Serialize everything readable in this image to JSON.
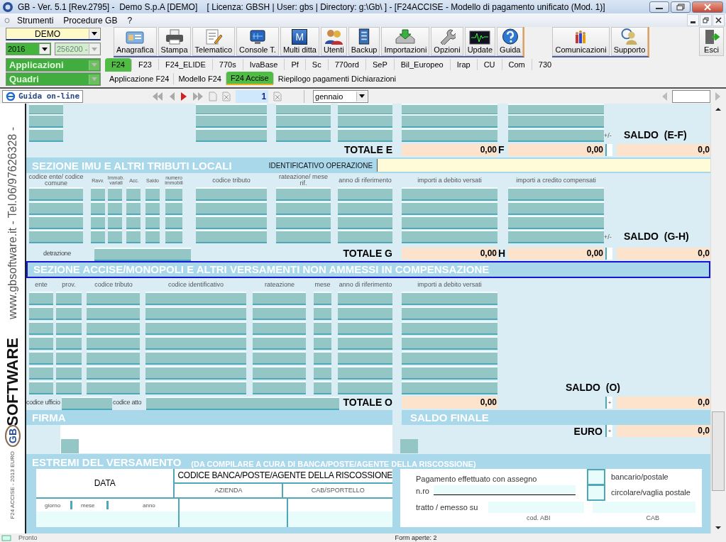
{
  "window": {
    "title": "GB - Ver. 5.1 [Rev.2795] -  Demo S.p.A [DEMO]    [ Licenza: GBSH | User: gbs | Directory: g:\\Gb\\ ] - [F24ACCISE - Modello di pagamento unificato (Mod. 1)]"
  },
  "menu": [
    "Strumenti",
    "Procedure GB",
    "?"
  ],
  "selectors": {
    "company": "DEMO",
    "year": "2016",
    "code": "256200 -",
    "application": "Applicazioni",
    "frames": "Quadri"
  },
  "toolbar": {
    "main": [
      {
        "label": "Anagrafica"
      },
      {
        "label": "Stampa"
      },
      {
        "label": "Telematico"
      },
      {
        "label": "Console T."
      },
      {
        "label": "Multi ditta",
        "glyph": "M"
      },
      {
        "label": "Utenti"
      },
      {
        "label": "Backup"
      },
      {
        "label": "Importazioni"
      },
      {
        "label": "Opzioni"
      },
      {
        "label": "Update"
      },
      {
        "label": "Guida"
      }
    ],
    "support": [
      {
        "label": "Comunicazioni"
      },
      {
        "label": "Supporto"
      }
    ],
    "exit": {
      "label": "Esci"
    }
  },
  "tabs": [
    {
      "label": "F24",
      "selected": true
    },
    {
      "label": "F23",
      "selected": false
    },
    {
      "label": "F24_ELIDE",
      "selected": false
    },
    {
      "label": "770s",
      "selected": false
    },
    {
      "label": "IvaBase",
      "selected": false
    },
    {
      "label": "Pf",
      "selected": false
    },
    {
      "label": "Sc",
      "selected": false
    },
    {
      "label": "770ord",
      "selected": false
    },
    {
      "label": "SeP",
      "selected": false
    },
    {
      "label": "Bil_Europeo",
      "selected": false
    },
    {
      "label": "Irap",
      "selected": false
    },
    {
      "label": "CU",
      "selected": false
    },
    {
      "label": "Com",
      "selected": false
    },
    {
      "label": "730",
      "selected": false
    }
  ],
  "subtabs": [
    {
      "label": "Applicazione F24",
      "selected": false
    },
    {
      "label": "Modello F24",
      "selected": false
    },
    {
      "label": "F24 Accise",
      "selected": true
    },
    {
      "label": "Riepilogo pagamenti Dichiarazioni",
      "selected": false
    }
  ],
  "nav": {
    "help_button": "Guida on-line",
    "page": "1",
    "month": "gennaio"
  },
  "side": {
    "contact": "www.gbsoftware.it - Tel.06/97626328 -",
    "logo_text": "SOFTWARE",
    "logo_mark": "GB",
    "form_code": "F24 ACCISE - 2013   EURO"
  },
  "section_e": {
    "total_label": "TOTALE E",
    "total_e": "0,00",
    "f_label": "F",
    "total_f": "0,00",
    "sign": "+/-",
    "saldo_label": "SALDO  (E-F)",
    "saldo": "0,0"
  },
  "section_imu": {
    "title": "SEZIONE IMU E ALTRI TRIBUTI LOCALI",
    "id_label": "IDENTIFICATIVO OPERAZIONE",
    "columns": [
      "codice ente/ codice comune",
      "Ravv.",
      "Immob. variati",
      "Acc.",
      "Saldo",
      "numero immobili",
      "codice tributo",
      "rateazione/ mese rif.",
      "anno di riferimento",
      "importi a debito versati",
      "importi a credito compensati"
    ],
    "deduction_label": "detrazione",
    "total_label": "TOTALE G",
    "total_g": "0,00",
    "h_label": "H",
    "total_h": "0,00",
    "sign": "+/-",
    "saldo_label": "SALDO  (G-H)",
    "saldo": "0,0"
  },
  "section_accise": {
    "title": "SEZIONE ACCISE/MONOPOLI E ALTRI VERSAMENTI NON AMMESSI IN COMPENSAZIONE",
    "columns": [
      "ente",
      "prov.",
      "codice tributo",
      "codice identificativo",
      "rateazione",
      "mese",
      "anno di riferimento",
      "importi a debito versati"
    ],
    "office_label": "codice ufficio",
    "deed_label": "codice atto",
    "total_label": "TOTALE O",
    "total_o": "0,00",
    "saldo_label": "SALDO  (O)",
    "sign": "+",
    "saldo": "0,0"
  },
  "signature": {
    "title": "FIRMA"
  },
  "final_balance": {
    "title": "SALDO FINALE",
    "euro_label": "EURO",
    "sign": "+",
    "value": "0,0"
  },
  "payment": {
    "title": "ESTREMI DEL VERSAMENTO",
    "note": "(DA COMPILARE A CURA DI BANCA/POSTE/AGENTE DELLA RISCOSSIONE)",
    "date_label": "DATA",
    "day": "giorno",
    "month": "mese",
    "year": "anno",
    "bank_label": "CODICE BANCA/POSTE/AGENTE DELLA RISCOSSIONE",
    "company": "AZIENDA",
    "branch": "CAB/SPORTELLO",
    "cheque_label": "Pagamento effettuato con assegno",
    "number_label": "n.ro",
    "drawn_label": "tratto / emesso su",
    "abi": "cod. ABI",
    "cab": "CAB",
    "cheque_types": [
      {
        "label": "bancario/postale",
        "checked": false
      },
      {
        "label": "circolare/vaglia postale",
        "checked": false
      }
    ]
  },
  "status_bar": {
    "status": "Pronto",
    "forms": "Form aperte: 2"
  }
}
